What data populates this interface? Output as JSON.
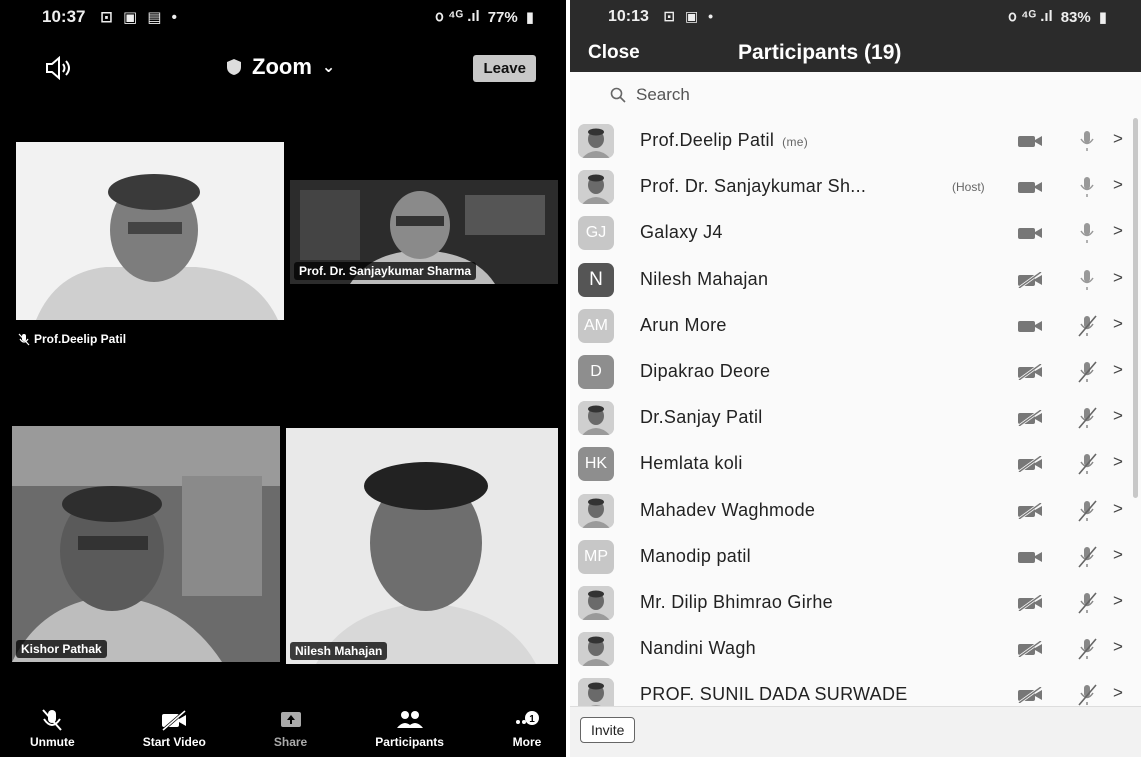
{
  "left_phone": {
    "status": {
      "time": "10:37",
      "glyphs": "⊡ ▣ ▤ •",
      "signal": "᪀ ⁴ᴳ .ıl",
      "battery": "77%"
    },
    "topbar": {
      "app_title": "Zoom",
      "leave_label": "Leave"
    },
    "tiles": {
      "deelip": "Prof.Deelip Patil",
      "sharma": "Prof. Dr. Sanjaykumar Sharma",
      "pathak": "Kishor Pathak",
      "nilesh": "Nilesh Mahajan"
    },
    "toolbar": {
      "unmute": "Unmute",
      "start_video": "Start Video",
      "share": "Share",
      "participants": "Participants",
      "more": "More",
      "more_badge": "1"
    }
  },
  "right_phone": {
    "status": {
      "time": "10:13",
      "glyphs": "⊡ ▣   •",
      "signal": "᪀ ⁴ᴳ .ıl",
      "battery": "83%"
    },
    "header": {
      "close_label": "Close",
      "title": "Participants (19)"
    },
    "search_placeholder": "Search",
    "participants": [
      {
        "name": "Prof.Deelip Patil",
        "tag": "(me)",
        "avatar": "",
        "avatar_style": "photo",
        "video": "on",
        "audio": "on"
      },
      {
        "name": "Prof. Dr. Sanjaykumar Sh...",
        "tag": "(Host)",
        "avatar": "",
        "avatar_style": "photo",
        "video": "on",
        "audio": "on"
      },
      {
        "name": "Galaxy J4",
        "tag": "",
        "avatar": "GJ",
        "avatar_style": "light",
        "video": "on",
        "audio": "on"
      },
      {
        "name": "Nilesh Mahajan",
        "tag": "",
        "avatar": "N",
        "avatar_style": "dark",
        "video": "off",
        "audio": "on"
      },
      {
        "name": "Arun More",
        "tag": "",
        "avatar": "AM",
        "avatar_style": "light",
        "video": "on",
        "audio": "off"
      },
      {
        "name": "Dipakrao Deore",
        "tag": "",
        "avatar": "D",
        "avatar_style": "med",
        "video": "off",
        "audio": "off"
      },
      {
        "name": "Dr.Sanjay Patil",
        "tag": "",
        "avatar": "",
        "avatar_style": "photo",
        "video": "off",
        "audio": "off"
      },
      {
        "name": "Hemlata koli",
        "tag": "",
        "avatar": "HK",
        "avatar_style": "med",
        "video": "off",
        "audio": "off"
      },
      {
        "name": "Mahadev Waghmode",
        "tag": "",
        "avatar": "",
        "avatar_style": "photo",
        "video": "off",
        "audio": "off"
      },
      {
        "name": "Manodip patil",
        "tag": "",
        "avatar": "MP",
        "avatar_style": "light",
        "video": "on",
        "audio": "off"
      },
      {
        "name": "Mr. Dilip Bhimrao Girhe",
        "tag": "",
        "avatar": "",
        "avatar_style": "photo",
        "video": "off",
        "audio": "off"
      },
      {
        "name": "Nandini Wagh",
        "tag": "",
        "avatar": "",
        "avatar_style": "photo",
        "video": "off",
        "audio": "off"
      },
      {
        "name": "PROF. SUNIL DADA SURWADE",
        "tag": "",
        "avatar": "",
        "avatar_style": "photo",
        "video": "off",
        "audio": "off"
      }
    ],
    "chevron": ">",
    "invite_label": "Invite"
  }
}
